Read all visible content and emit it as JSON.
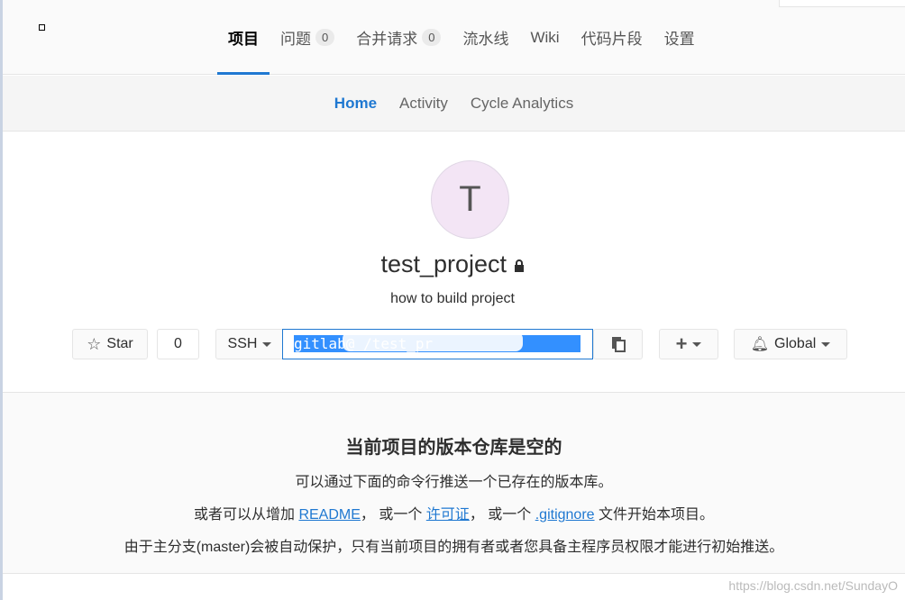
{
  "top_tabs": [
    {
      "label": "项目"
    },
    {
      "label": "问题",
      "count": "0"
    },
    {
      "label": "合并请求",
      "count": "0"
    },
    {
      "label": "流水线"
    },
    {
      "label": "Wiki"
    },
    {
      "label": "代码片段"
    },
    {
      "label": "设置"
    }
  ],
  "sub_tabs": [
    "Home",
    "Activity",
    "Cycle Analytics"
  ],
  "project": {
    "initial": "T",
    "name": "test_project",
    "description": "how to build project"
  },
  "star": {
    "label": "Star",
    "count": "0"
  },
  "clone": {
    "protocol": "SSH",
    "url": "gitlab@                      /test_pr"
  },
  "notification": {
    "label": "Global"
  },
  "empty": {
    "title": "当前项目的版本仓库是空的",
    "line1": "可以通过下面的命令行推送一个已存在的版本库。",
    "l2a": "或者可以从增加 ",
    "readme": "README",
    "l2b": "， 或一个 ",
    "license": "许可证",
    "l2c": "， 或一个 ",
    "gitignore": ".gitignore",
    "l2d": " 文件开始本项目。",
    "line3": "由于主分支(master)会被自动保护，只有当前项目的拥有者或者您具备主程序员权限才能进行初始推送。"
  },
  "watermark": "https://blog.csdn.net/SundayO",
  "colors": {
    "accent": "#1f78d1"
  }
}
